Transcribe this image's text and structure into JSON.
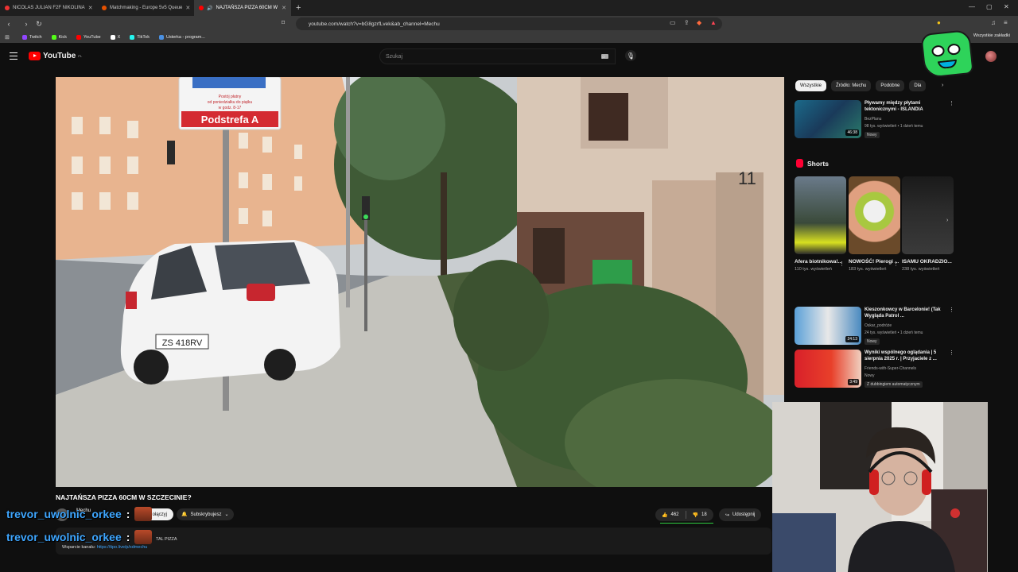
{
  "browser": {
    "tabs": [
      {
        "title": "NICOLAS JULIAN F2F NIKOLINA",
        "active": false,
        "color": "#e53935"
      },
      {
        "title": "Matchmaking - Europe 5v5 Queue",
        "active": false,
        "color": "#e65100"
      },
      {
        "title": "NAJTAŃSZA PIZZA 60CM W",
        "active": true,
        "color": "#ff0000"
      }
    ],
    "url": "youtube.com/watch?v=bG8gzrfLvek&ab_channel=Mechu",
    "bookmarks": [
      {
        "label": "Twitch",
        "color": "#9146ff"
      },
      {
        "label": "Kick",
        "color": "#53fc18"
      },
      {
        "label": "YouTube",
        "color": "#ff0000"
      },
      {
        "label": "X",
        "color": "#ffffff"
      },
      {
        "label": "TikTok",
        "color": "#25f4ee"
      },
      {
        "label": "Usterka - program...",
        "color": "#4a90e2"
      }
    ],
    "all_bookmarks": "Wszystkie zakładki"
  },
  "header": {
    "logo": "YouTube",
    "logo_region": "PL",
    "search_placeholder": "Szukaj"
  },
  "video": {
    "title": "NAJTAŃSZA PIZZA 60CM W SZCZECINIE?",
    "plate": "ZS 418RV",
    "sign_title": "Podstrefa A",
    "sign_lines": [
      "Postój płatny",
      "od poniedziałku do piątku",
      "w godz. 8-17"
    ],
    "house_number": "11"
  },
  "channel": {
    "name": "Mechu",
    "join_label": "ołączyj",
    "subscribe_label": "Subskrybujesz"
  },
  "actions": {
    "likes": "462",
    "dislikes": "18",
    "share": "Udostępnij",
    "like_ratio": 0.96
  },
  "description": {
    "support_label": "Wsparcie kanału:",
    "support_link": "https://tipo.live/p/xdmechu",
    "extra": "TAL PIZZA"
  },
  "chat": [
    {
      "user": "trevor_uwolnic_orkee",
      "sep": ":"
    },
    {
      "user": "trevor_uwolnic_orkee",
      "sep": ":"
    }
  ],
  "sidebar": {
    "chips": [
      {
        "label": "Wszystkie",
        "active": true
      },
      {
        "label": "Źródło: Mechu",
        "active": false
      },
      {
        "label": "Podobne",
        "active": false
      },
      {
        "label": "Dla",
        "active": false
      }
    ],
    "rec1": {
      "title": "Pływamy między płytami tektonicznymi - ISLANDIA",
      "channel": "BezPlanu",
      "meta": "98 tys. wyświetleń • 1 dzień temu",
      "badge": "Nowy",
      "duration": "46:38"
    },
    "shorts_title": "Shorts",
    "shorts": [
      {
        "title": "Afera biotnikowa!...",
        "views": "110 tys. wyświetleń"
      },
      {
        "title": "NOWOŚĆ! Pierogi ...",
        "views": "183 tys. wyświetleń"
      },
      {
        "title": "ISAMU OKRADZIO...",
        "views": "238 tys. wyświetleń"
      }
    ],
    "rec2": {
      "title": "Kieszonkowcy w Barcelonie! (Tak Wygląda Patrol ...",
      "channel": "Oskar_podróże",
      "meta": "24 tys. wyświetleń • 1 dzień temu",
      "badge": "Nowy",
      "duration": "24:13"
    },
    "rec3": {
      "title": "Wyniki wspólnego oglądania | 5 sierpnia 2025 r. | Przyjaciele z ...",
      "channel": "Friends-with-Super-Channels",
      "meta": "Nowy",
      "badge": "Z dubbingiem automatycznym",
      "duration": "3:49"
    }
  }
}
